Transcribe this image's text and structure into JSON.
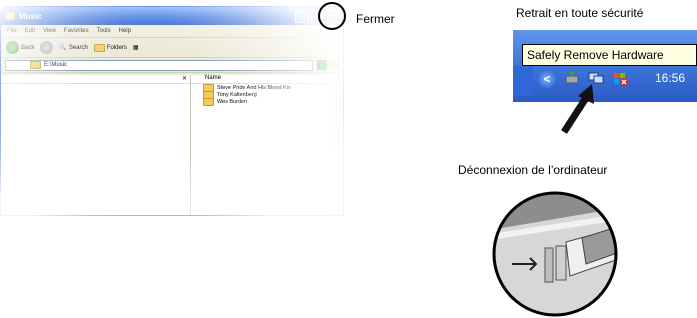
{
  "explorer": {
    "title": "Music",
    "menu": [
      "File",
      "Edit",
      "View",
      "Favorites",
      "Tools",
      "Help"
    ],
    "toolbar": {
      "back": "Back",
      "search": "Search",
      "folders": "Folders"
    },
    "address": "E:\\Music",
    "go": "Go",
    "column_name": "Name",
    "files": [
      "Steve Pride And His Blood Kin",
      "Tony Kaltenberg",
      "Wes Burden"
    ]
  },
  "callouts": {
    "close": "Fermer",
    "safe_remove": "Retrait en toute sécurité",
    "disconnect": "Déconnexion de l’ordinateur"
  },
  "taskbar": {
    "tooltip": "Safely Remove Hardware",
    "time": "16:56"
  },
  "colors": {
    "title_blue": "#0b4fd6",
    "taskbar_blue": "#3b73d7",
    "tooltip_bg": "#ffffe1",
    "close_red": "#c2401f"
  },
  "icons": [
    "folder-icon",
    "back-icon",
    "forward-icon",
    "search-icon",
    "folders-icon",
    "views-icon",
    "go-icon",
    "close-icon",
    "minimize-icon",
    "maximize-icon",
    "safely-remove-icon",
    "network-icon",
    "security-alert-icon",
    "usb-icon"
  ]
}
